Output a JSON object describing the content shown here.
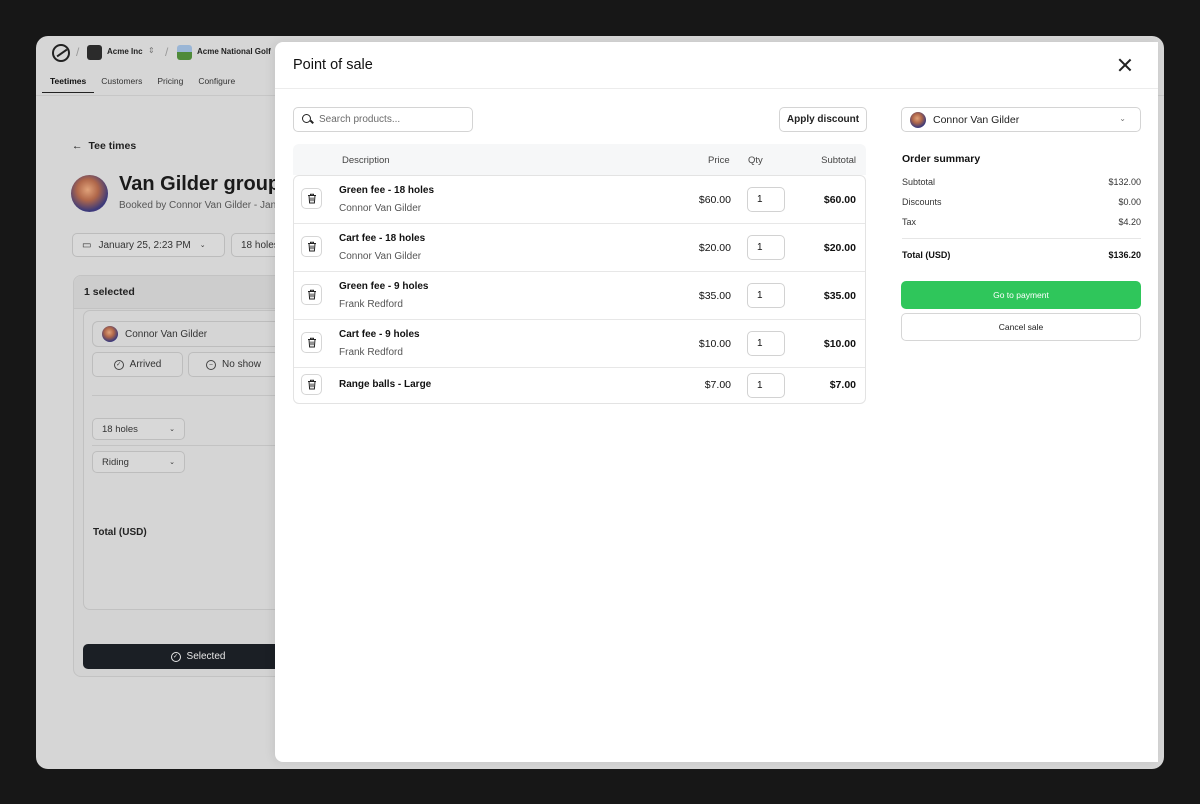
{
  "background_app": {
    "org_name": "Acme Inc",
    "course_name": "Acme National Golf",
    "nav_tabs": [
      "Teetimes",
      "Customers",
      "Pricing",
      "Configure"
    ],
    "back_link": "Tee times",
    "group_title": "Van Gilder group",
    "group_subtitle": "Booked by Connor Van Gilder - Jan",
    "date_pill": "January 25, 2:23 PM",
    "holes_pill": "18 holes",
    "selected_count": "1 selected",
    "guest_name": "Connor Van Gilder",
    "arrived_label": "Arrived",
    "no_show_label": "No show",
    "holes_select": "18 holes",
    "cart_select": "Riding",
    "total_label": "Total (USD)",
    "selected_button": "Selected"
  },
  "modal": {
    "title": "Point of sale",
    "search_placeholder": "Search products...",
    "apply_discount": "Apply discount",
    "columns": {
      "description": "Description",
      "price": "Price",
      "qty": "Qty",
      "subtotal": "Subtotal"
    },
    "items": [
      {
        "name": "Green fee - 18 holes",
        "customer": "Connor Van Gilder",
        "price": "$60.00",
        "qty": "1",
        "subtotal": "$60.00"
      },
      {
        "name": "Cart fee - 18 holes",
        "customer": "Connor Van Gilder",
        "price": "$20.00",
        "qty": "1",
        "subtotal": "$20.00"
      },
      {
        "name": "Green fee - 9 holes",
        "customer": "Frank Redford",
        "price": "$35.00",
        "qty": "1",
        "subtotal": "$35.00"
      },
      {
        "name": "Cart fee - 9 holes",
        "customer": "Frank Redford",
        "price": "$10.00",
        "qty": "1",
        "subtotal": "$10.00"
      },
      {
        "name": "Range balls - Large",
        "customer": "",
        "price": "$7.00",
        "qty": "1",
        "subtotal": "$7.00"
      }
    ],
    "customer_select": "Connor Van Gilder",
    "summary": {
      "title": "Order summary",
      "subtotal_label": "Subtotal",
      "subtotal_value": "$132.00",
      "discounts_label": "Discounts",
      "discounts_value": "$0.00",
      "tax_label": "Tax",
      "tax_value": "$4.20",
      "total_label": "Total (USD)",
      "total_value": "$136.20"
    },
    "pay_button": "Go to payment",
    "cancel_button": "Cancel sale"
  },
  "colors": {
    "pay_green": "#2fc65b",
    "overlay": "#d6d6d6",
    "selected_button": "#1b1f25"
  }
}
